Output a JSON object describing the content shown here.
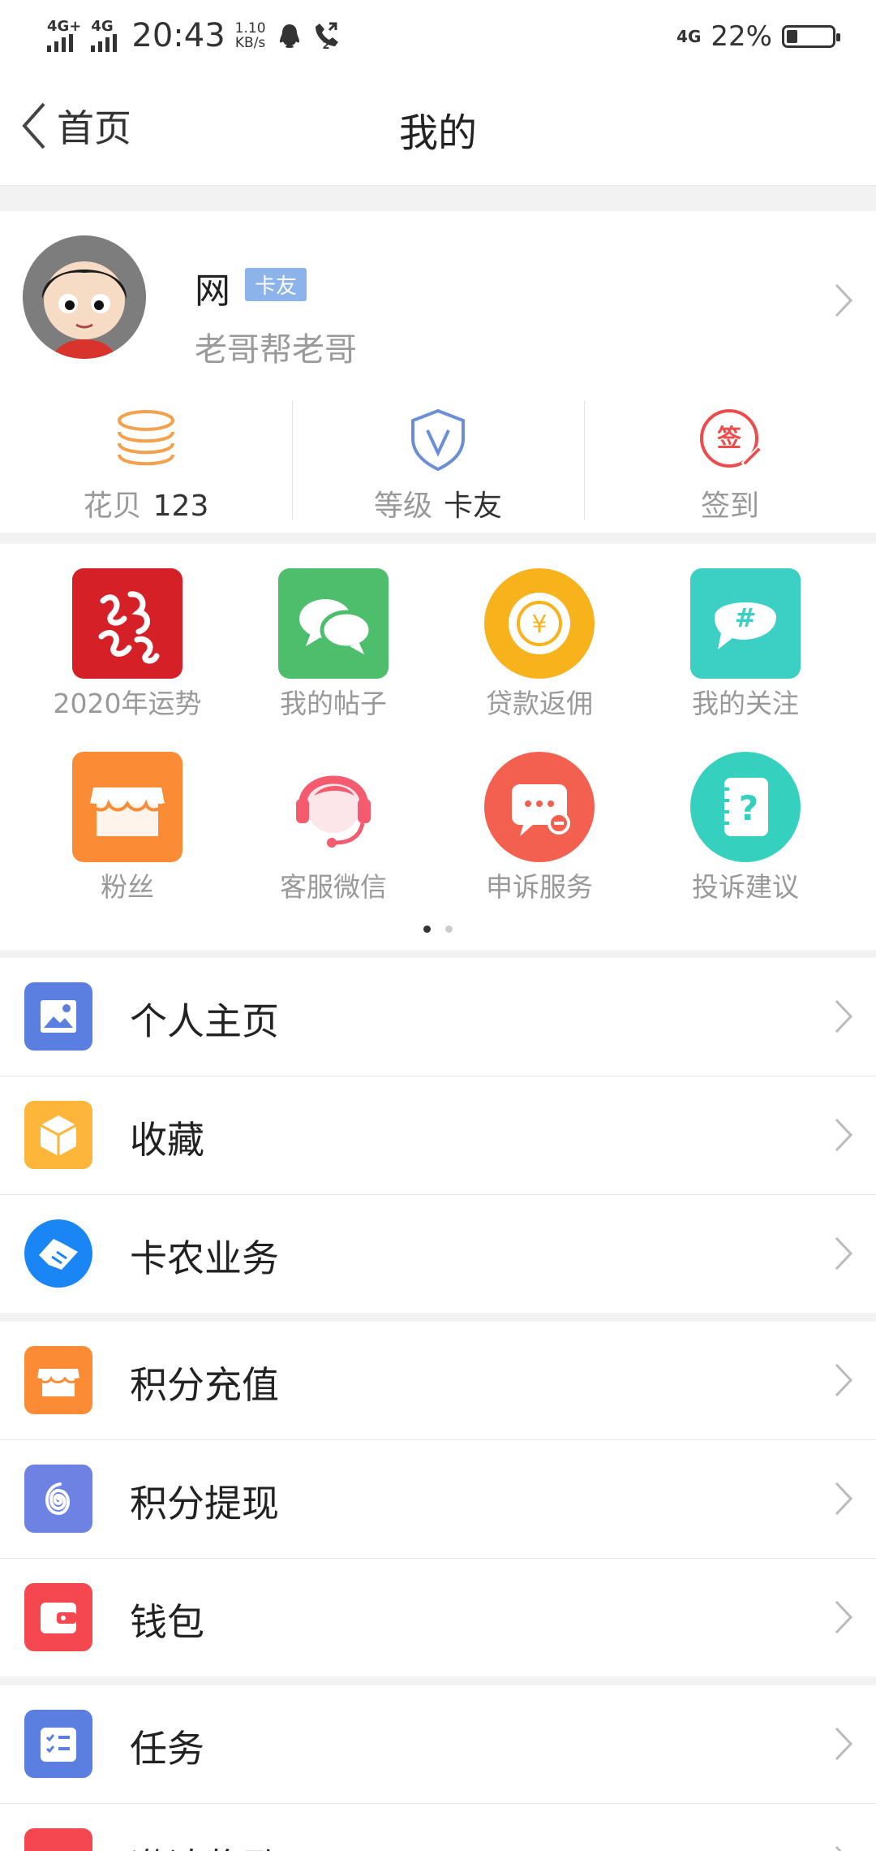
{
  "status_bar": {
    "signal1": "4G+",
    "signal2": "4G",
    "time": "20:43",
    "speed_value": "1.10",
    "speed_unit": "KB/s",
    "call_index": "2",
    "network": "4G",
    "battery": "22%",
    "icons": [
      "qq-icon",
      "call-icon",
      "battery-icon"
    ]
  },
  "nav": {
    "back_label": "首页",
    "title": "我的"
  },
  "profile": {
    "name": "网",
    "badge": "卡友",
    "subtitle": "老哥帮老哥"
  },
  "stats": [
    {
      "label": "花贝",
      "value": "123",
      "icon": "coins-icon"
    },
    {
      "label": "等级",
      "value": "卡友",
      "icon": "shield-icon"
    },
    {
      "label": "签到",
      "value": "",
      "icon": "sign-in-icon"
    }
  ],
  "grid": [
    {
      "label": "2020年运势",
      "icon": "fortune-icon",
      "color": "#d62027"
    },
    {
      "label": "我的帖子",
      "icon": "posts-icon",
      "color": "#4dbf6c"
    },
    {
      "label": "贷款返佣",
      "icon": "yuan-coin-icon",
      "color": "#f7b21c"
    },
    {
      "label": "我的关注",
      "icon": "hashtag-icon",
      "color": "#3ccfc4"
    },
    {
      "label": "粉丝",
      "icon": "store-icon",
      "color": "#fb8c35"
    },
    {
      "label": "客服微信",
      "icon": "headset-icon",
      "color": "#f45b6e"
    },
    {
      "label": "申诉服务",
      "icon": "chat-dots-icon",
      "color": "#f4604f"
    },
    {
      "label": "投诉建议",
      "icon": "question-book-icon",
      "color": "#36d0bf"
    }
  ],
  "pager": {
    "pages": 2,
    "current": 1
  },
  "list_groups": [
    [
      {
        "label": "个人主页",
        "icon": "image-icon",
        "color": "#5b7fe0"
      },
      {
        "label": "收藏",
        "icon": "cube-icon",
        "color": "#fdb53a"
      },
      {
        "label": "卡农业务",
        "icon": "handshake-icon",
        "color": "#1a86f5"
      }
    ],
    [
      {
        "label": "积分充值",
        "icon": "shop-icon",
        "color": "#fb8c35"
      },
      {
        "label": "积分提现",
        "icon": "spiral-icon",
        "color": "#6d82e3"
      },
      {
        "label": "钱包",
        "icon": "wallet-icon",
        "color": "#f4474f"
      }
    ],
    [
      {
        "label": "任务",
        "icon": "tasks-icon",
        "color": "#5b7fe0"
      },
      {
        "label": "邀请奖励",
        "icon": "gift-icon",
        "color": "#f4474f"
      }
    ]
  ]
}
